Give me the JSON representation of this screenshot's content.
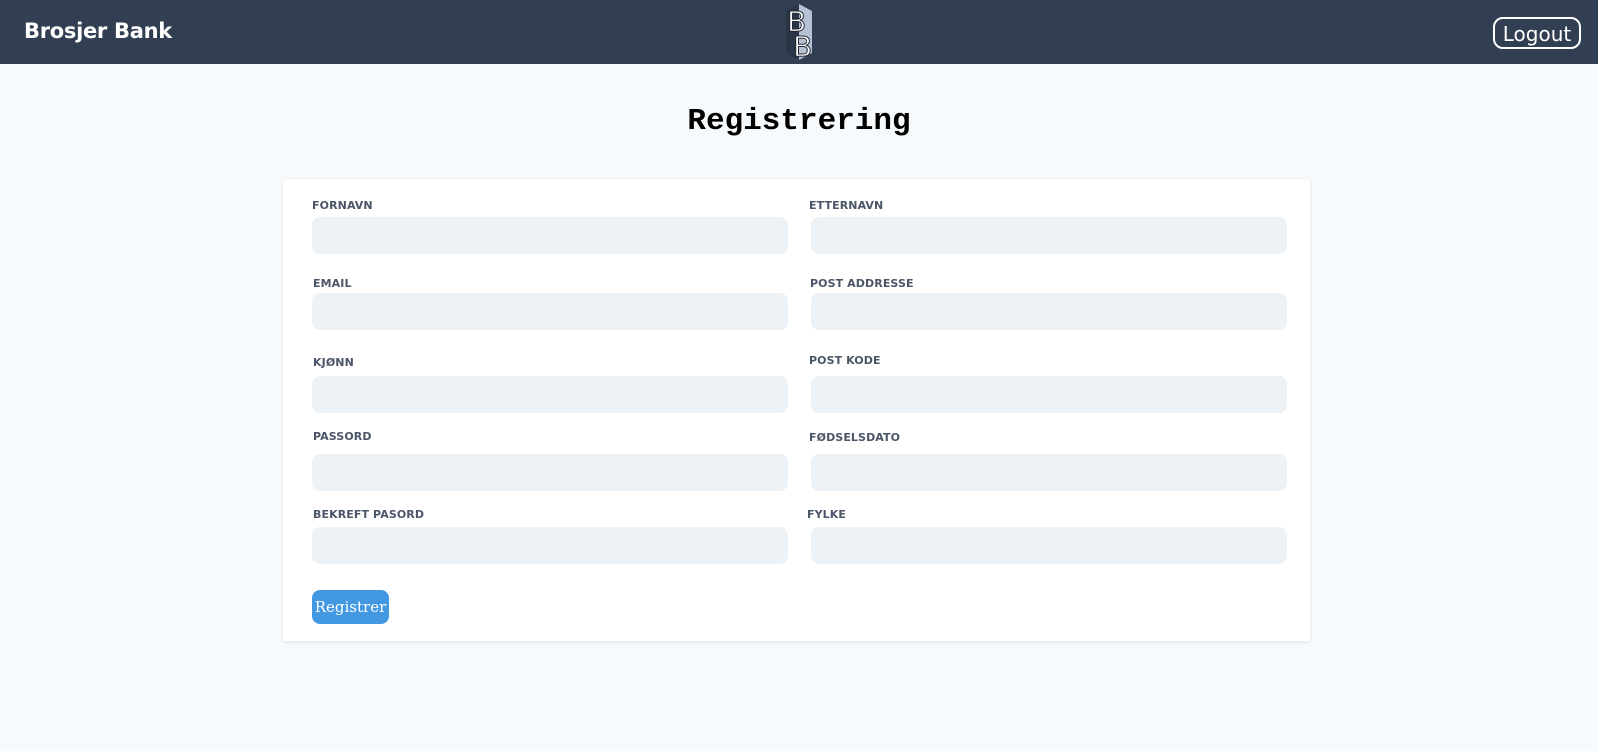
{
  "navbar": {
    "brand": "Brosjer Bank",
    "logo_icon": "bb-logo-icon",
    "logout_label": "Logout"
  },
  "page": {
    "title": "Registrering"
  },
  "form": {
    "fields": {
      "fornavn": {
        "label": "FORNAVN",
        "value": "",
        "placeholder": ""
      },
      "etternavn": {
        "label": "ETTERNAVN",
        "value": "",
        "placeholder": ""
      },
      "email": {
        "label": "EMAIL",
        "value": "",
        "placeholder": ""
      },
      "post_addresse": {
        "label": "POST ADDRESSE",
        "value": "",
        "placeholder": ""
      },
      "kjonn": {
        "label": "KJØNN",
        "value": "",
        "placeholder": ""
      },
      "post_kode": {
        "label": "POST KODE",
        "value": "",
        "placeholder": ""
      },
      "passord": {
        "label": "PASSORD",
        "value": "",
        "placeholder": ""
      },
      "fodselsdato": {
        "label": "FØDSELSDATO",
        "value": "",
        "placeholder": ""
      },
      "bekreft_passord": {
        "label": "BEKREFT PASORD",
        "value": "",
        "placeholder": ""
      },
      "fylke": {
        "label": "FYLKE",
        "value": "",
        "placeholder": ""
      }
    },
    "submit_label": "Registrer"
  },
  "colors": {
    "navbar_bg": "#323f52",
    "page_bg": "#f7fafc",
    "input_bg": "#edf2f7",
    "button_bg": "#4299e1",
    "label_text": "#4a5568"
  }
}
